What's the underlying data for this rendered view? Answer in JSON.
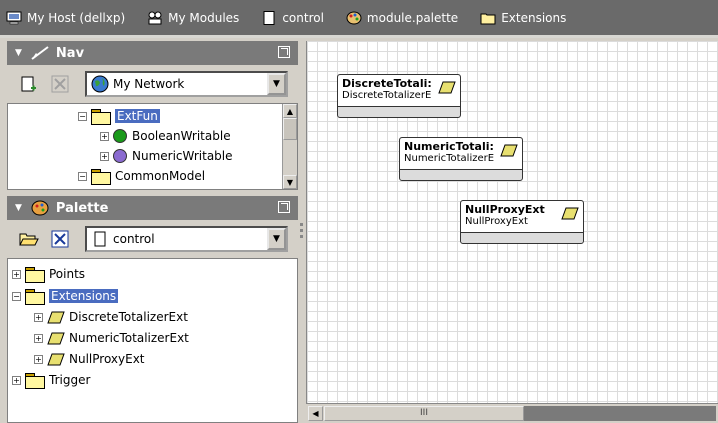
{
  "breadcrumbs": [
    {
      "label": "My Host (dellxp)",
      "icon": "host-icon"
    },
    {
      "label": "My Modules",
      "icon": "modules-icon"
    },
    {
      "label": "control",
      "icon": "document-icon"
    },
    {
      "label": "module.palette",
      "icon": "palette-icon"
    },
    {
      "label": "Extensions",
      "icon": "folder-icon"
    }
  ],
  "nav": {
    "title": "Nav",
    "combo_value": "My Network",
    "tree": [
      {
        "label": "ExtFun",
        "selected": true
      },
      {
        "label": "BooleanWritable",
        "dot_color": "#1a9a1a"
      },
      {
        "label": "NumericWritable",
        "dot_color": "#8a6ad0"
      },
      {
        "label": "CommonModel"
      }
    ]
  },
  "palette": {
    "title": "Palette",
    "combo_value": "control",
    "tree": [
      {
        "label": "Points"
      },
      {
        "label": "Extensions",
        "selected": true
      },
      {
        "label": "DiscreteTotalizerExt"
      },
      {
        "label": "NumericTotalizerExt"
      },
      {
        "label": "NullProxyExt"
      },
      {
        "label": "Trigger"
      }
    ]
  },
  "wiresheet": {
    "components": [
      {
        "name": "DiscreteTotali:",
        "type": "DiscreteTotalizerE"
      },
      {
        "name": "NumericTotali:",
        "type": "NumericTotalizerE"
      },
      {
        "name": "NullProxyExt",
        "type": "NullProxyExt"
      }
    ]
  },
  "hscroll_label": "III",
  "colors": {
    "selection": "#4a6cc0",
    "header": "#7a7a7a",
    "topbar": "#6a6a6a"
  }
}
